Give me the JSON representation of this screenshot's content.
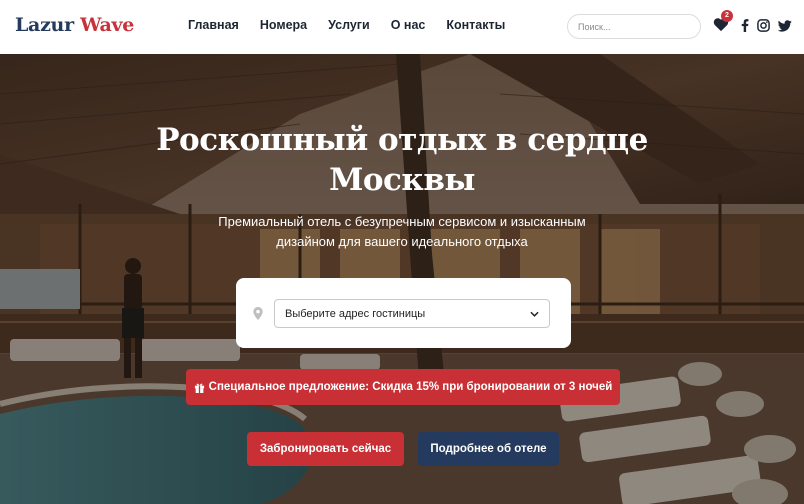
{
  "header": {
    "logo_part1": "Lazur",
    "logo_part2": "Wave",
    "nav": [
      "Главная",
      "Номера",
      "Услуги",
      "О нас",
      "Контакты"
    ],
    "search_placeholder": "Поиск...",
    "wishlist_count": "2",
    "social_icons": [
      "facebook-icon",
      "instagram-icon",
      "twitter-icon"
    ]
  },
  "hero": {
    "title_line1": "Роскошный отдых в сердце",
    "title_line2": "Москвы",
    "subtitle_line1": "Премиальный отель с безупречным сервисом и изысканным",
    "subtitle_line2": "дизайном для вашего идеального отдыха",
    "select_value": "Выберите адрес гостиницы",
    "promo_text": "Специальное предложение: Скидка 15% при бронировании от 3 ночей",
    "book_button": "Забронировать сейчас",
    "more_button": "Подробнее об отеле"
  },
  "colors": {
    "brand_navy": "#243a5e",
    "brand_red": "#c93036"
  }
}
